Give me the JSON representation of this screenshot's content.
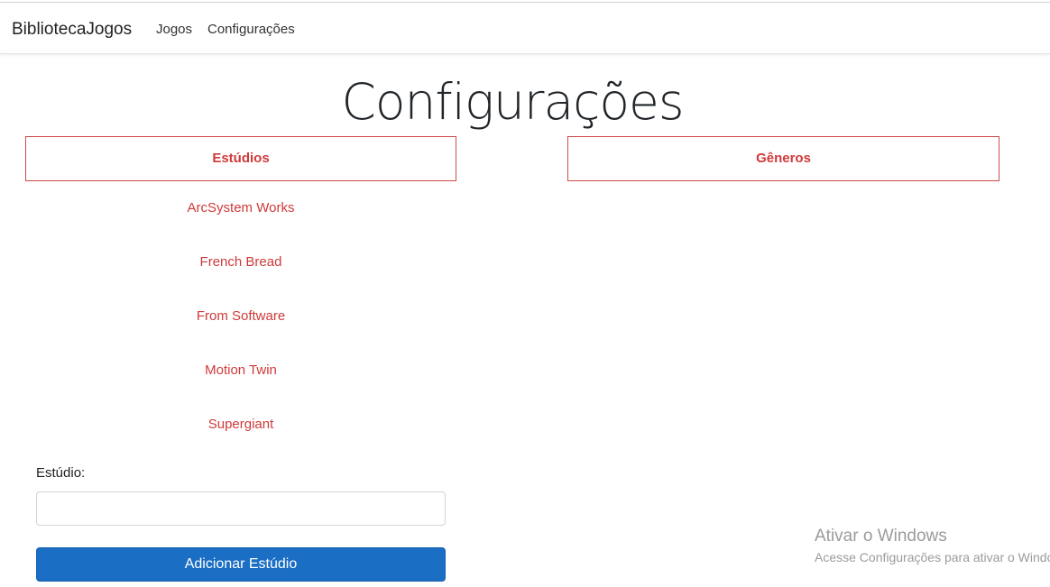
{
  "navbar": {
    "brand": "BibliotecaJogos",
    "links": [
      "Jogos",
      "Configurações"
    ]
  },
  "page": {
    "title": "Configurações"
  },
  "tabs": {
    "estudios": "Estúdios",
    "generos": "Gêneros"
  },
  "studios": [
    "ArcSystem Works",
    "French Bread",
    "From Software",
    "Motion Twin",
    "Supergiant"
  ],
  "form": {
    "label": "Estúdio:",
    "value": "",
    "submit_label": "Adicionar Estúdio"
  },
  "watermark": {
    "title": "Ativar o Windows",
    "subtitle": "Acesse Configurações para ativar o Windows."
  },
  "colors": {
    "accent": "#d03a3a",
    "primary_button": "#1a6ec4"
  }
}
